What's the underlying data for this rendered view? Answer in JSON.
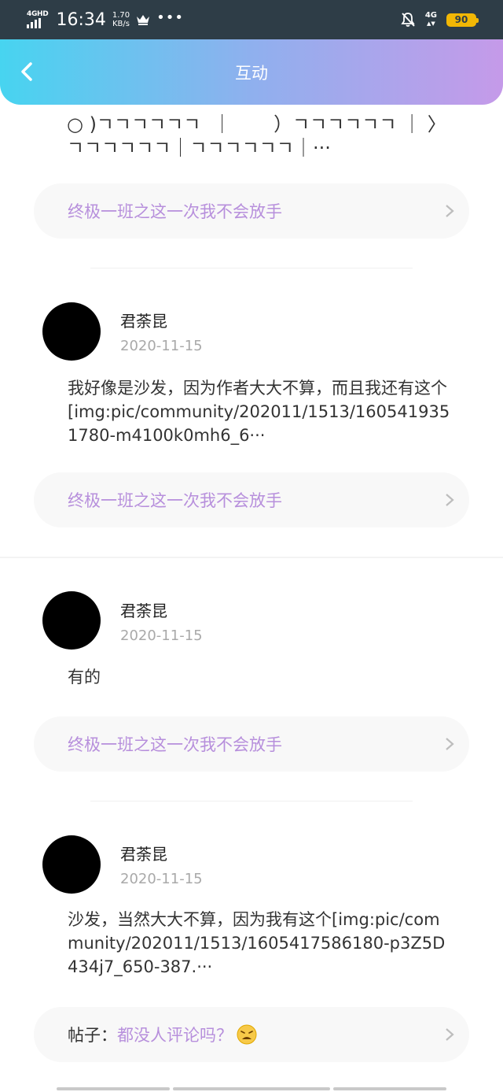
{
  "status_bar": {
    "network": "4GHD",
    "time": "16:34",
    "speed_value": "1.70",
    "speed_unit": "KB/s",
    "more": "•••",
    "signal_type": "4G",
    "battery": "90",
    "colors": {
      "battery": "#f2b705",
      "bar": "#2e3d47"
    }
  },
  "header": {
    "title": "互动",
    "back_icon": "chevron-left-icon",
    "gradient": [
      "#47d4f0",
      "#8fb0ee",
      "#c59ae9"
    ]
  },
  "top_fragment": {
    "text": "○ )ㄱㄱㄱㄱㄱㄱ  ｜       ）ㄱㄱㄱㄱㄱㄱ ｜ 〉)\nㄱㄱㄱㄱㄱㄱ｜ㄱㄱㄱㄱㄱㄱ｜···",
    "link": "终极一班之这一次我不会放手"
  },
  "comments": [
    {
      "name": "君荼昆",
      "date": "2020-11-15",
      "text": "我好像是沙发，因为作者大大不算，而且我还有这个[img:pic/community/202011/1513/1605419351780-m4100k0mh6_6···",
      "link": "终极一班之这一次我不会放手"
    },
    {
      "name": "君荼昆",
      "date": "2020-11-15",
      "text": "有的",
      "link": "终极一班之这一次我不会放手"
    },
    {
      "name": "君荼昆",
      "date": "2020-11-15",
      "text": "沙发，当然大大不算，因为我有这个[img:pic/community/202011/1513/1605417586180-p3Z5D434j7_650-387.···",
      "link_prefix": "帖子：",
      "link": "都没人评论吗？",
      "link_emoji": "weary-face-icon"
    }
  ],
  "accent_color": "#b78fdc"
}
